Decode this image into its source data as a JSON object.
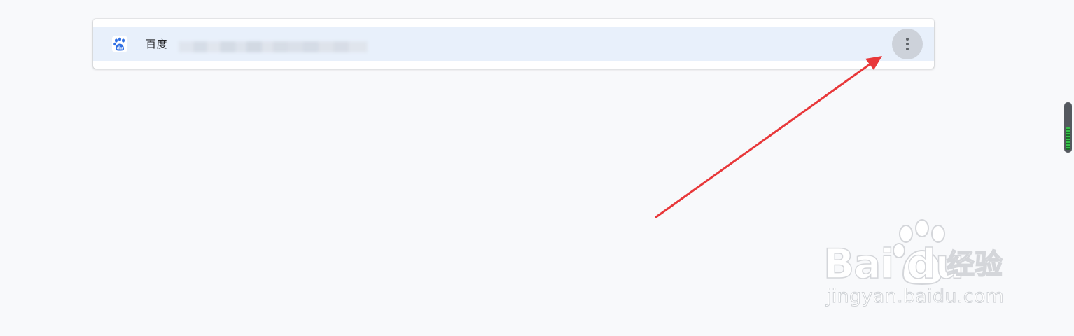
{
  "site_entry": {
    "name": "百度",
    "favicon": "baidu-paw-icon",
    "url_obscured": true,
    "menu_icon": "more-vert-icon"
  },
  "watermark": {
    "logo_text": "Bai du",
    "cn_text": "经验",
    "url": "jingyan.baidu.com"
  },
  "colors": {
    "row_highlight": "#e8f0fb",
    "menu_button_bg": "#cdd2da",
    "arrow": "#e8383a",
    "page_bg": "#f8f9fb"
  }
}
